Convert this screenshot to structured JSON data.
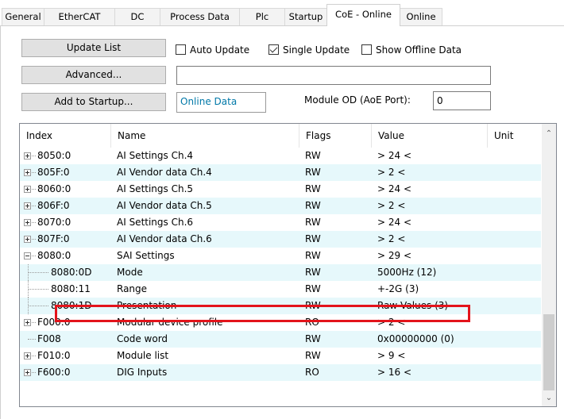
{
  "tabs": [
    "General",
    "EtherCAT",
    "DC",
    "Process Data",
    "Plc",
    "Startup",
    "CoE - Online",
    "Online"
  ],
  "active_tab": "CoE - Online",
  "buttons": {
    "update_list": "Update List",
    "advanced": "Advanced...",
    "add_to_startup": "Add to Startup..."
  },
  "checkboxes": {
    "auto_update": {
      "label": "Auto Update",
      "checked": false
    },
    "single_update": {
      "label": "Single Update",
      "checked": true
    },
    "show_offline": {
      "label": "Show Offline Data",
      "checked": false
    }
  },
  "status_field": "",
  "online_data": "Online Data",
  "module_od_label": "Module OD (AoE Port):",
  "module_od_value": "0",
  "columns": [
    "Index",
    "Name",
    "Flags",
    "Value",
    "Unit"
  ],
  "rows": [
    {
      "index": "8050:0",
      "name": "AI Settings Ch.4",
      "flags": "RW",
      "value": "> 24 <",
      "level": 0,
      "expander": "plus"
    },
    {
      "index": "805F:0",
      "name": "AI Vendor data Ch.4",
      "flags": "RW",
      "value": "> 2 <",
      "level": 0,
      "expander": "plus"
    },
    {
      "index": "8060:0",
      "name": "AI Settings Ch.5",
      "flags": "RW",
      "value": "> 24 <",
      "level": 0,
      "expander": "plus"
    },
    {
      "index": "806F:0",
      "name": "AI Vendor data Ch.5",
      "flags": "RW",
      "value": "> 2 <",
      "level": 0,
      "expander": "plus"
    },
    {
      "index": "8070:0",
      "name": "AI Settings Ch.6",
      "flags": "RW",
      "value": "> 24 <",
      "level": 0,
      "expander": "plus"
    },
    {
      "index": "807F:0",
      "name": "AI Vendor data Ch.6",
      "flags": "RW",
      "value": "> 2 <",
      "level": 0,
      "expander": "plus"
    },
    {
      "index": "8080:0",
      "name": "SAI Settings",
      "flags": "RW",
      "value": "> 29 <",
      "level": 0,
      "expander": "minus"
    },
    {
      "index": "8080:0D",
      "name": "Mode",
      "flags": "RW",
      "value": "5000Hz (12)",
      "level": 1,
      "expander": ""
    },
    {
      "index": "8080:11",
      "name": "Range",
      "flags": "RW",
      "value": "+-2G (3)",
      "level": 1,
      "expander": ""
    },
    {
      "index": "8080:1D",
      "name": "Presentation",
      "flags": "RW",
      "value": "Raw Values (3)",
      "level": 1,
      "expander": ""
    },
    {
      "index": "F000:0",
      "name": "Modular device profile",
      "flags": "RO",
      "value": "> 2 <",
      "level": 0,
      "expander": "plus"
    },
    {
      "index": "F008",
      "name": "Code word",
      "flags": "RW",
      "value": "0x00000000 (0)",
      "level": 0,
      "expander": ""
    },
    {
      "index": "F010:0",
      "name": "Module list",
      "flags": "RW",
      "value": "> 9 <",
      "level": 0,
      "expander": "plus"
    },
    {
      "index": "F600:0",
      "name": "DIG Inputs",
      "flags": "RO",
      "value": "> 16 <",
      "level": 0,
      "expander": "plus"
    }
  ],
  "highlight_color": "#e3141b",
  "row_alt_color": "#e6f8fb"
}
